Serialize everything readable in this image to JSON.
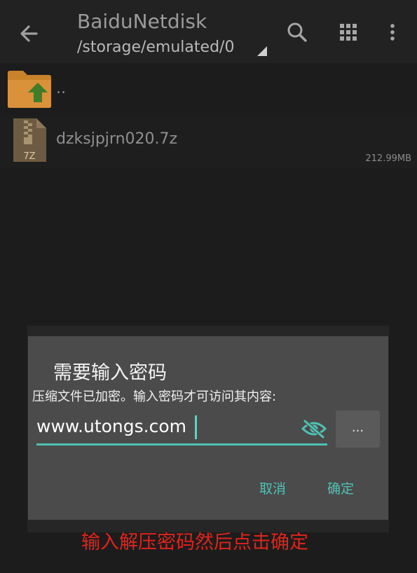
{
  "toolbar": {
    "title": "BaiduNetdisk",
    "path": "/storage/emulated/0",
    "icons": [
      "back-arrow-icon",
      "search-icon",
      "grid-view-icon",
      "more-vert-icon"
    ]
  },
  "files": [
    {
      "name": "..",
      "icon": "folder-up-icon",
      "size": ""
    },
    {
      "name": "dzksjpjrn020.7z",
      "icon": "archive-7z-icon",
      "size": "212.99MB",
      "icon_label": "7Z"
    }
  ],
  "dialog": {
    "title": "需要输入密码",
    "message": "压缩文件已加密。输入密码才可访问其内容:",
    "password_value": "www.utongs.com",
    "more_label": "...",
    "cancel_label": "取消",
    "ok_label": "确定"
  },
  "caption": "输入解压密码然后点击确定",
  "colors": {
    "accent": "#4fc2b4",
    "background": "#1c1c1c",
    "dialog": "#4b4b4b",
    "caption": "#e2231a",
    "folder": "#c8832a"
  }
}
